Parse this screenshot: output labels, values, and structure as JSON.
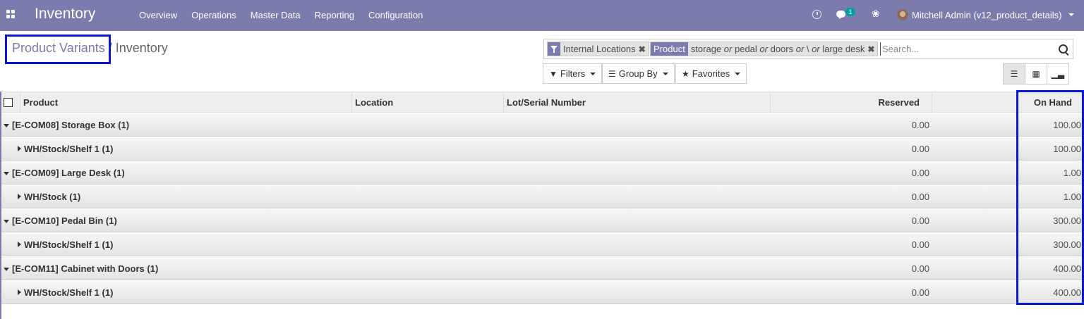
{
  "navbar": {
    "brand": "Inventory",
    "menu": [
      "Overview",
      "Operations",
      "Master Data",
      "Reporting",
      "Configuration"
    ],
    "chat_count": "1",
    "user": "Mitchell Admin (v12_product_details)"
  },
  "breadcrumb": {
    "parent": "Product Variants",
    "separator": " / ",
    "current": "Inventory"
  },
  "search": {
    "facets": [
      {
        "label": "",
        "value": "Internal Locations"
      },
      {
        "label": "Product",
        "parts": [
          "storage",
          " or ",
          "pedal",
          " or ",
          "doors",
          " or ",
          "\\",
          " or ",
          "large desk"
        ]
      }
    ],
    "placeholder": "Search..."
  },
  "buttons": {
    "filters": "Filters",
    "group_by": "Group By",
    "favorites": "Favorites"
  },
  "columns": [
    "Product",
    "Location",
    "Lot/Serial Number",
    "Reserved",
    "On Hand"
  ],
  "rows": [
    {
      "level": 0,
      "label": "[E-COM08] Storage Box (1)",
      "reserved": "0.00",
      "on_hand": "100.00"
    },
    {
      "level": 1,
      "label": "WH/Stock/Shelf 1 (1)",
      "reserved": "0.00",
      "on_hand": "100.00"
    },
    {
      "level": 0,
      "label": "[E-COM09] Large Desk (1)",
      "reserved": "0.00",
      "on_hand": "1.00"
    },
    {
      "level": 1,
      "label": "WH/Stock (1)",
      "reserved": "0.00",
      "on_hand": "1.00"
    },
    {
      "level": 0,
      "label": "[E-COM10] Pedal Bin (1)",
      "reserved": "0.00",
      "on_hand": "300.00"
    },
    {
      "level": 1,
      "label": "WH/Stock/Shelf 1 (1)",
      "reserved": "0.00",
      "on_hand": "300.00"
    },
    {
      "level": 0,
      "label": "[E-COM11] Cabinet with Doors (1)",
      "reserved": "0.00",
      "on_hand": "400.00"
    },
    {
      "level": 1,
      "label": "WH/Stock/Shelf 1 (1)",
      "reserved": "0.00",
      "on_hand": "400.00"
    }
  ]
}
